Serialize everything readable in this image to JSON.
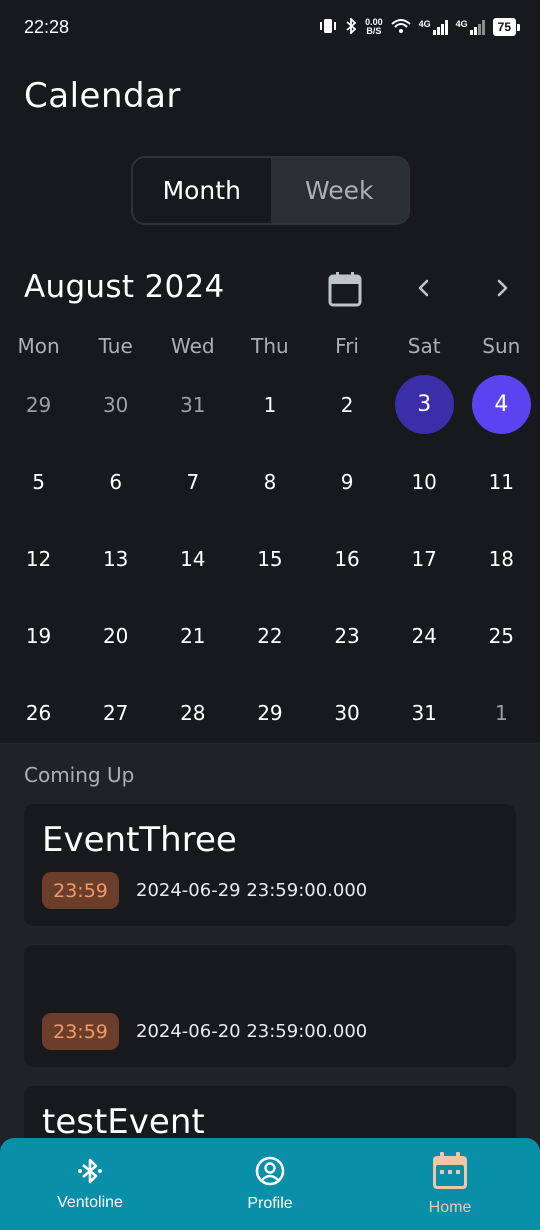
{
  "status_bar": {
    "time": "22:28",
    "net_speed_value": "0.00",
    "net_speed_unit": "B/S",
    "network_1": "4G",
    "network_2": "4G",
    "battery": "75"
  },
  "header": {
    "title": "Calendar"
  },
  "view_toggle": {
    "month_label": "Month",
    "week_label": "Week",
    "selected": "Month"
  },
  "calendar": {
    "month_label": "August 2024",
    "weekdays": [
      "Mon",
      "Tue",
      "Wed",
      "Thu",
      "Fri",
      "Sat",
      "Sun"
    ],
    "weeks": [
      [
        "29",
        "30",
        "31",
        "1",
        "2",
        "3",
        "4"
      ],
      [
        "5",
        "6",
        "7",
        "8",
        "9",
        "10",
        "11"
      ],
      [
        "12",
        "13",
        "14",
        "15",
        "16",
        "17",
        "18"
      ],
      [
        "19",
        "20",
        "21",
        "22",
        "23",
        "24",
        "25"
      ],
      [
        "26",
        "27",
        "28",
        "29",
        "30",
        "31",
        "1"
      ]
    ],
    "selected_day": "3",
    "today": "4"
  },
  "coming_up": {
    "label": "Coming Up",
    "events": [
      {
        "title": "EventThree",
        "time": "23:59",
        "datetime": "2024-06-29 23:59:00.000"
      },
      {
        "title": "",
        "time": "23:59",
        "datetime": "2024-06-20 23:59:00.000"
      },
      {
        "title": "testEvent",
        "time": "",
        "datetime": ""
      }
    ]
  },
  "bottom_nav": {
    "items": [
      {
        "label": "Ventoline",
        "icon": "bluetooth-icon"
      },
      {
        "label": "Profile",
        "icon": "profile-icon"
      },
      {
        "label": "Home",
        "icon": "calendar-icon"
      }
    ],
    "active": "Home"
  },
  "colors": {
    "background": "#17191c",
    "accent_today": "#5b44f0",
    "accent_selected": "#3a2fa8",
    "chip_bg": "#6b3e2c",
    "chip_text": "#f09a6b",
    "nav_bg": "#0a8fa8"
  }
}
